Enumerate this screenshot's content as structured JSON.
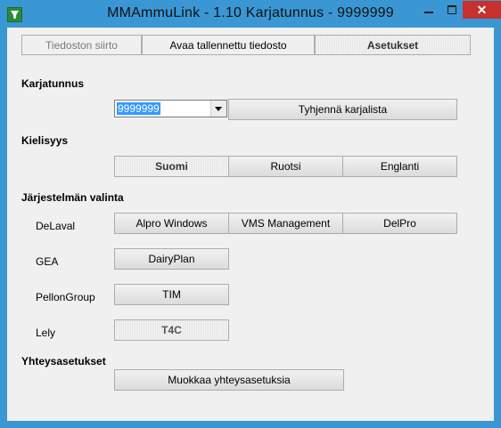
{
  "window": {
    "title": "MMAmmuLink - 1.10     Karjatunnus - 9999999",
    "close_label": "✕",
    "minimize_icon": "minimize-icon",
    "maximize_icon": "maximize-icon"
  },
  "tabs": [
    {
      "label": "Tiedoston siirto",
      "state": "disabled"
    },
    {
      "label": "Avaa tallennettu tiedosto",
      "state": "normal"
    },
    {
      "label": "Asetukset",
      "state": "active"
    }
  ],
  "karjatunnus": {
    "title": "Karjatunnus",
    "selected_value": "9999999",
    "clear_button": "Tyhjennä karjalista"
  },
  "kielisyys": {
    "title": "Kielisyys",
    "options": [
      "Suomi",
      "Ruotsi",
      "Englanti"
    ],
    "selected": "Suomi"
  },
  "jarjestelma": {
    "title": "Järjestelmän valinta",
    "delaval": {
      "label": "DeLaval",
      "options": [
        "Alpro Windows",
        "VMS Management",
        "DelPro"
      ]
    },
    "gea": {
      "label": "GEA",
      "option": "DairyPlan"
    },
    "pellon": {
      "label": "PellonGroup",
      "option": "TIM"
    },
    "lely": {
      "label": "Lely",
      "option": "T4C"
    }
  },
  "yhteys": {
    "title": "Yhteysasetukset",
    "edit_button": "Muokkaa yhteysasetuksia"
  }
}
